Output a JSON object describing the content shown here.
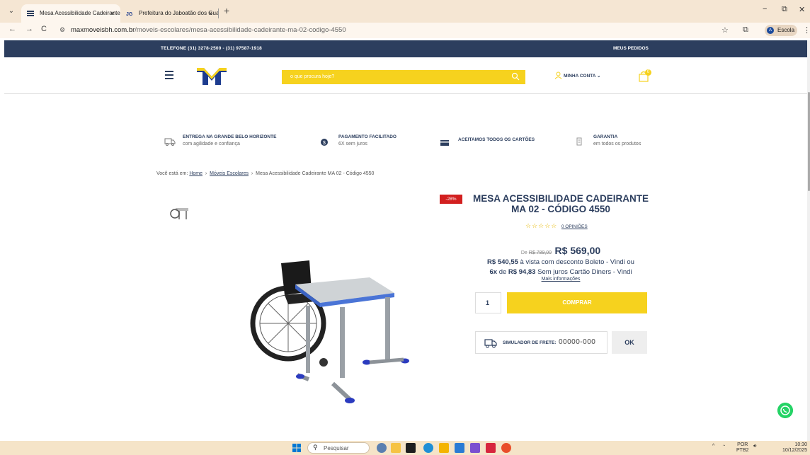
{
  "browser": {
    "tabs": [
      {
        "label": "Mesa Acessibilidade Cadeirante",
        "active": true
      },
      {
        "label": "Prefeitura do Jaboatão dos Gua",
        "active": false
      }
    ],
    "tab_close": "×",
    "new_tab": "+",
    "url_host": "maxmoveisbh.com.br",
    "url_path": "/moveis-escolares/mesa-acessibilidade-cadeirante-ma-02-codigo-4550",
    "profile_initial": "A",
    "profile_label": "Escola",
    "window_controls": {
      "minimize": "−",
      "restore": "⧉",
      "close": "✕"
    },
    "nav": {
      "back": "←",
      "forward": "→",
      "reload": "C"
    }
  },
  "site": {
    "telefone": "TELEFONE (31) 3278-2500 - (31) 97587-1918",
    "meus_pedidos": "MEUS PEDIDOS",
    "search_placeholder": "o que procura hoje?",
    "minha_conta": "MINHA CONTA ⌄",
    "cart_count": "0",
    "benefits": [
      {
        "title": "ENTREGA NA GRANDE BELO HORIZONTE",
        "subtitle": "com agilidade e confiança"
      },
      {
        "title": "PAGAMENTO FACILITADO",
        "subtitle": "6X sem juros"
      },
      {
        "title": "ACEITAMOS TODOS OS CARTÕES",
        "subtitle": ""
      },
      {
        "title": "GARANTIA",
        "subtitle": "em todos os produtos"
      }
    ],
    "breadcrumb": {
      "prefix": "Você está em:",
      "home": "Home",
      "sep": "›",
      "category": "Móveis Escolares",
      "current": "Mesa Acessibilidade Cadeirante MA 02 - Código 4550"
    }
  },
  "product": {
    "discount_badge": "-28%",
    "title_line1": "MESA ACESSIBILIDADE CADEIRANTE",
    "title_line2": "MA 02 - CÓDIGO 4550",
    "stars": "☆☆☆☆☆",
    "reviews": "0 OPINIÕES",
    "old_price_prefix": "De",
    "old_price": "R$ 789,00",
    "price": "R$ 569,00",
    "boleto_price": "R$ 540,55",
    "boleto_text": "à vista com desconto Boleto - Vindi ou",
    "installments": "6x",
    "installments_de": "de",
    "installment_value": "R$ 94,83",
    "installments_text": "Sem juros Cartão Diners - Vindi",
    "more_info": "Mais informações",
    "quantity": "1",
    "buy_label": "COMPRAR",
    "frete_label": "SIMULADOR DE FRETE:",
    "cep_placeholder": "00000-000",
    "ok_label": "OK"
  },
  "taskbar": {
    "search_label": "Pesquisar",
    "lang": "POR",
    "lang2": "PTB2",
    "time": "10:30",
    "date": "10/12/2025"
  },
  "colors": {
    "navy": "#2c3e5e",
    "yellow": "#f6d21e",
    "discount_red": "#d21f1f",
    "whatsapp_green": "#25d366"
  }
}
